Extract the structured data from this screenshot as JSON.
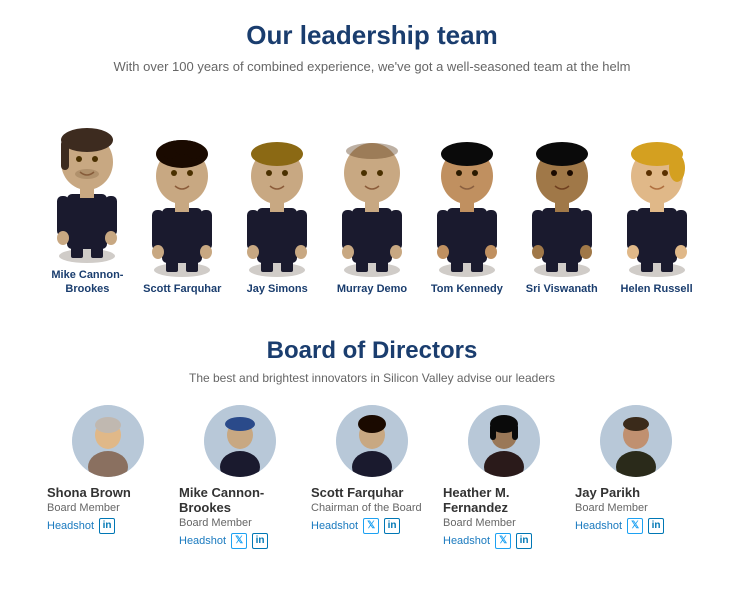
{
  "leadership": {
    "title": "Our leadership team",
    "subtitle": "With over 100 years of combined experience, we've got a well-seasoned team at the helm",
    "members": [
      {
        "name": "Mike Cannon-Brookes",
        "id": "mike-cb"
      },
      {
        "name": "Scott Farquhar",
        "id": "scott-f"
      },
      {
        "name": "Jay Simons",
        "id": "jay-s"
      },
      {
        "name": "Murray Demo",
        "id": "murray-d"
      },
      {
        "name": "Tom Kennedy",
        "id": "tom-k"
      },
      {
        "name": "Sri Viswanath",
        "id": "sri-v"
      },
      {
        "name": "Helen Russell",
        "id": "helen-r"
      }
    ]
  },
  "board": {
    "title": "Board of Directors",
    "subtitle": "The best and brightest innovators in Silicon Valley advise our leaders",
    "members": [
      {
        "name": "Shona Brown",
        "role": "Board Member",
        "headshot_label": "Headshot",
        "has_twitter": false,
        "has_linkedin": true
      },
      {
        "name": "Mike Cannon-Brookes",
        "role": "Board Member",
        "headshot_label": "Headshot",
        "has_twitter": true,
        "has_linkedin": true
      },
      {
        "name": "Scott Farquhar",
        "role": "Chairman of the Board",
        "headshot_label": "Headshot",
        "has_twitter": true,
        "has_linkedin": true
      },
      {
        "name": "Heather M. Fernandez",
        "role": "Board Member",
        "headshot_label": "Headshot",
        "has_twitter": true,
        "has_linkedin": true
      },
      {
        "name": "Jay Parikh",
        "role": "Board Member",
        "headshot_label": "Headshot",
        "has_twitter": true,
        "has_linkedin": true
      }
    ]
  },
  "icons": {
    "twitter": "𝕏",
    "linkedin": "in"
  }
}
